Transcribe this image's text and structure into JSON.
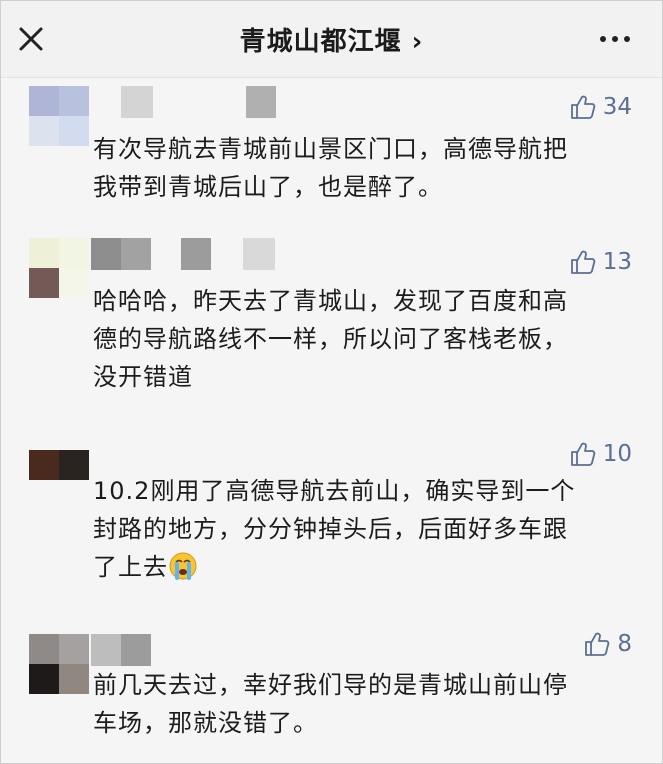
{
  "header": {
    "title": "青城山都江堰",
    "title_arrow": "›",
    "close_icon": "close-icon",
    "more_icon": "more-icon"
  },
  "comments": [
    {
      "likes": "34",
      "text": "有次导航去青城前山景区门口，高德导航把\n我带到青城后山了，也是醉了。"
    },
    {
      "likes": "13",
      "text": "哈哈哈，昨天去了青城山，发现了百度和高\n德的导航路线不一样，所以问了客栈老板，\n没开错道"
    },
    {
      "likes": "10",
      "text": "10.2刚用了高德导航去前山，确实导到一个\n封路的地方，分分钟掉头后，后面好多车跟\n了上去"
    },
    {
      "likes": "8",
      "text": "前几天去过，幸好我们导的是青城山前山停\n车场，那就没错了。"
    }
  ],
  "colors": {
    "like_blue": "#5a6f92",
    "text": "#1c1c1c",
    "background": "#f5f5f5"
  }
}
